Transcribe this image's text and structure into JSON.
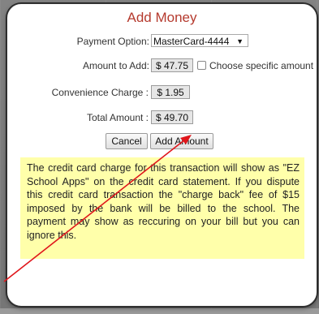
{
  "dialog": {
    "title": "Add Money"
  },
  "payment": {
    "label": "Payment Option:",
    "selected": "MasterCard-4444"
  },
  "amount": {
    "label": "Amount to Add:",
    "value": "$ 47.75",
    "checkbox_label": "Choose specific amount",
    "checkbox_checked": false
  },
  "convenience": {
    "label": "Convenience Charge :",
    "value": "$ 1.95"
  },
  "total": {
    "label": "Total Amount :",
    "value": "$ 49.70"
  },
  "buttons": {
    "cancel_label": "Cancel",
    "add_label": "Add Amount"
  },
  "notice": {
    "text": "The credit card charge for this transaction will show as \"EZ School Apps\" on the credit card statement. If you dispute this credit card transaction the \"charge back\" fee of $15 imposed by the bank will be billed to the school. The payment may show as reccuring on your bill but you can ignore this."
  },
  "colors": {
    "title": "#b53a2e",
    "notice_bg": "#ffffaa",
    "annotation_arrow": "#e0161b"
  },
  "icons": {
    "dropdown": "caret-down-icon",
    "annotation": "red-arrow-icon"
  }
}
